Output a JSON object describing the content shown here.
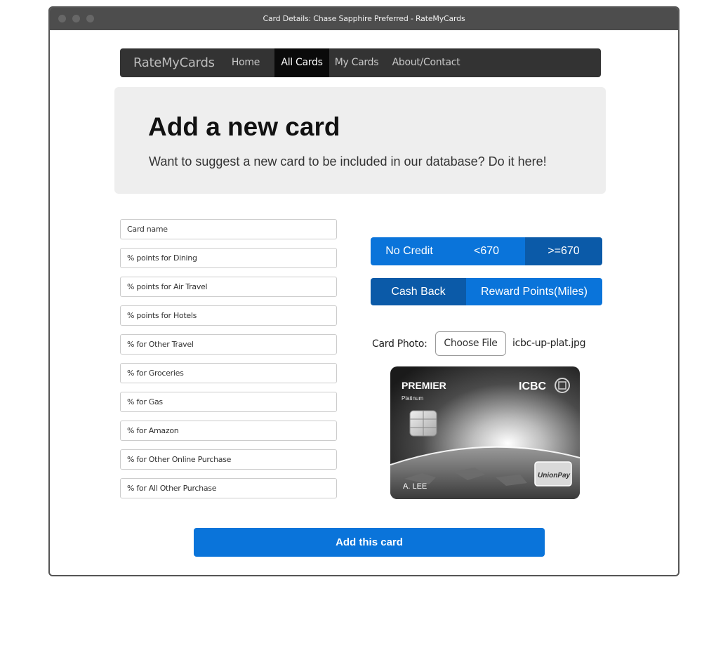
{
  "window": {
    "title": "Card Details: Chase Sapphire Preferred - RateMyCards"
  },
  "nav": {
    "brand": "RateMyCards",
    "items": [
      {
        "label": "Home"
      },
      {
        "label": "All Cards",
        "active": true
      },
      {
        "label": "My Cards"
      },
      {
        "label": "About/Contact"
      }
    ]
  },
  "header": {
    "title": "Add a new card",
    "subtitle": "Want to suggest a new card to be included in our database? Do it here!"
  },
  "form": {
    "fields": [
      {
        "placeholder": "Card name"
      },
      {
        "placeholder": "% points for Dining"
      },
      {
        "placeholder": "% points for Air Travel"
      },
      {
        "placeholder": "% points for Hotels"
      },
      {
        "placeholder": "% for Other Travel"
      },
      {
        "placeholder": "% for Groceries"
      },
      {
        "placeholder": "% for Gas"
      },
      {
        "placeholder": "% for Amazon"
      },
      {
        "placeholder": "% for Other Online Purchase"
      },
      {
        "placeholder": "% for All Other Purchase"
      }
    ],
    "credit_options": [
      {
        "label": "No Credit",
        "selected": false
      },
      {
        "label": "<670",
        "selected": false
      },
      {
        "label": ">=670",
        "selected": true
      }
    ],
    "reward_options": [
      {
        "label": "Cash Back",
        "selected": true
      },
      {
        "label": "Reward Points(Miles)",
        "selected": false
      }
    ],
    "photo_label": "Card Photo:",
    "choose_file_label": "Choose File",
    "file_name": "icbc-up-plat.jpg",
    "submit_label": "Add this card"
  },
  "card_preview": {
    "product": "PREMIER",
    "tier": "Platinum",
    "bank": "ICBC",
    "network": "UnionPay",
    "holder": "A. LEE"
  },
  "colors": {
    "primary": "#0a74da",
    "primary_selected": "#0b5aa8",
    "navbar": "#333333",
    "jumbotron": "#eeeeee"
  }
}
